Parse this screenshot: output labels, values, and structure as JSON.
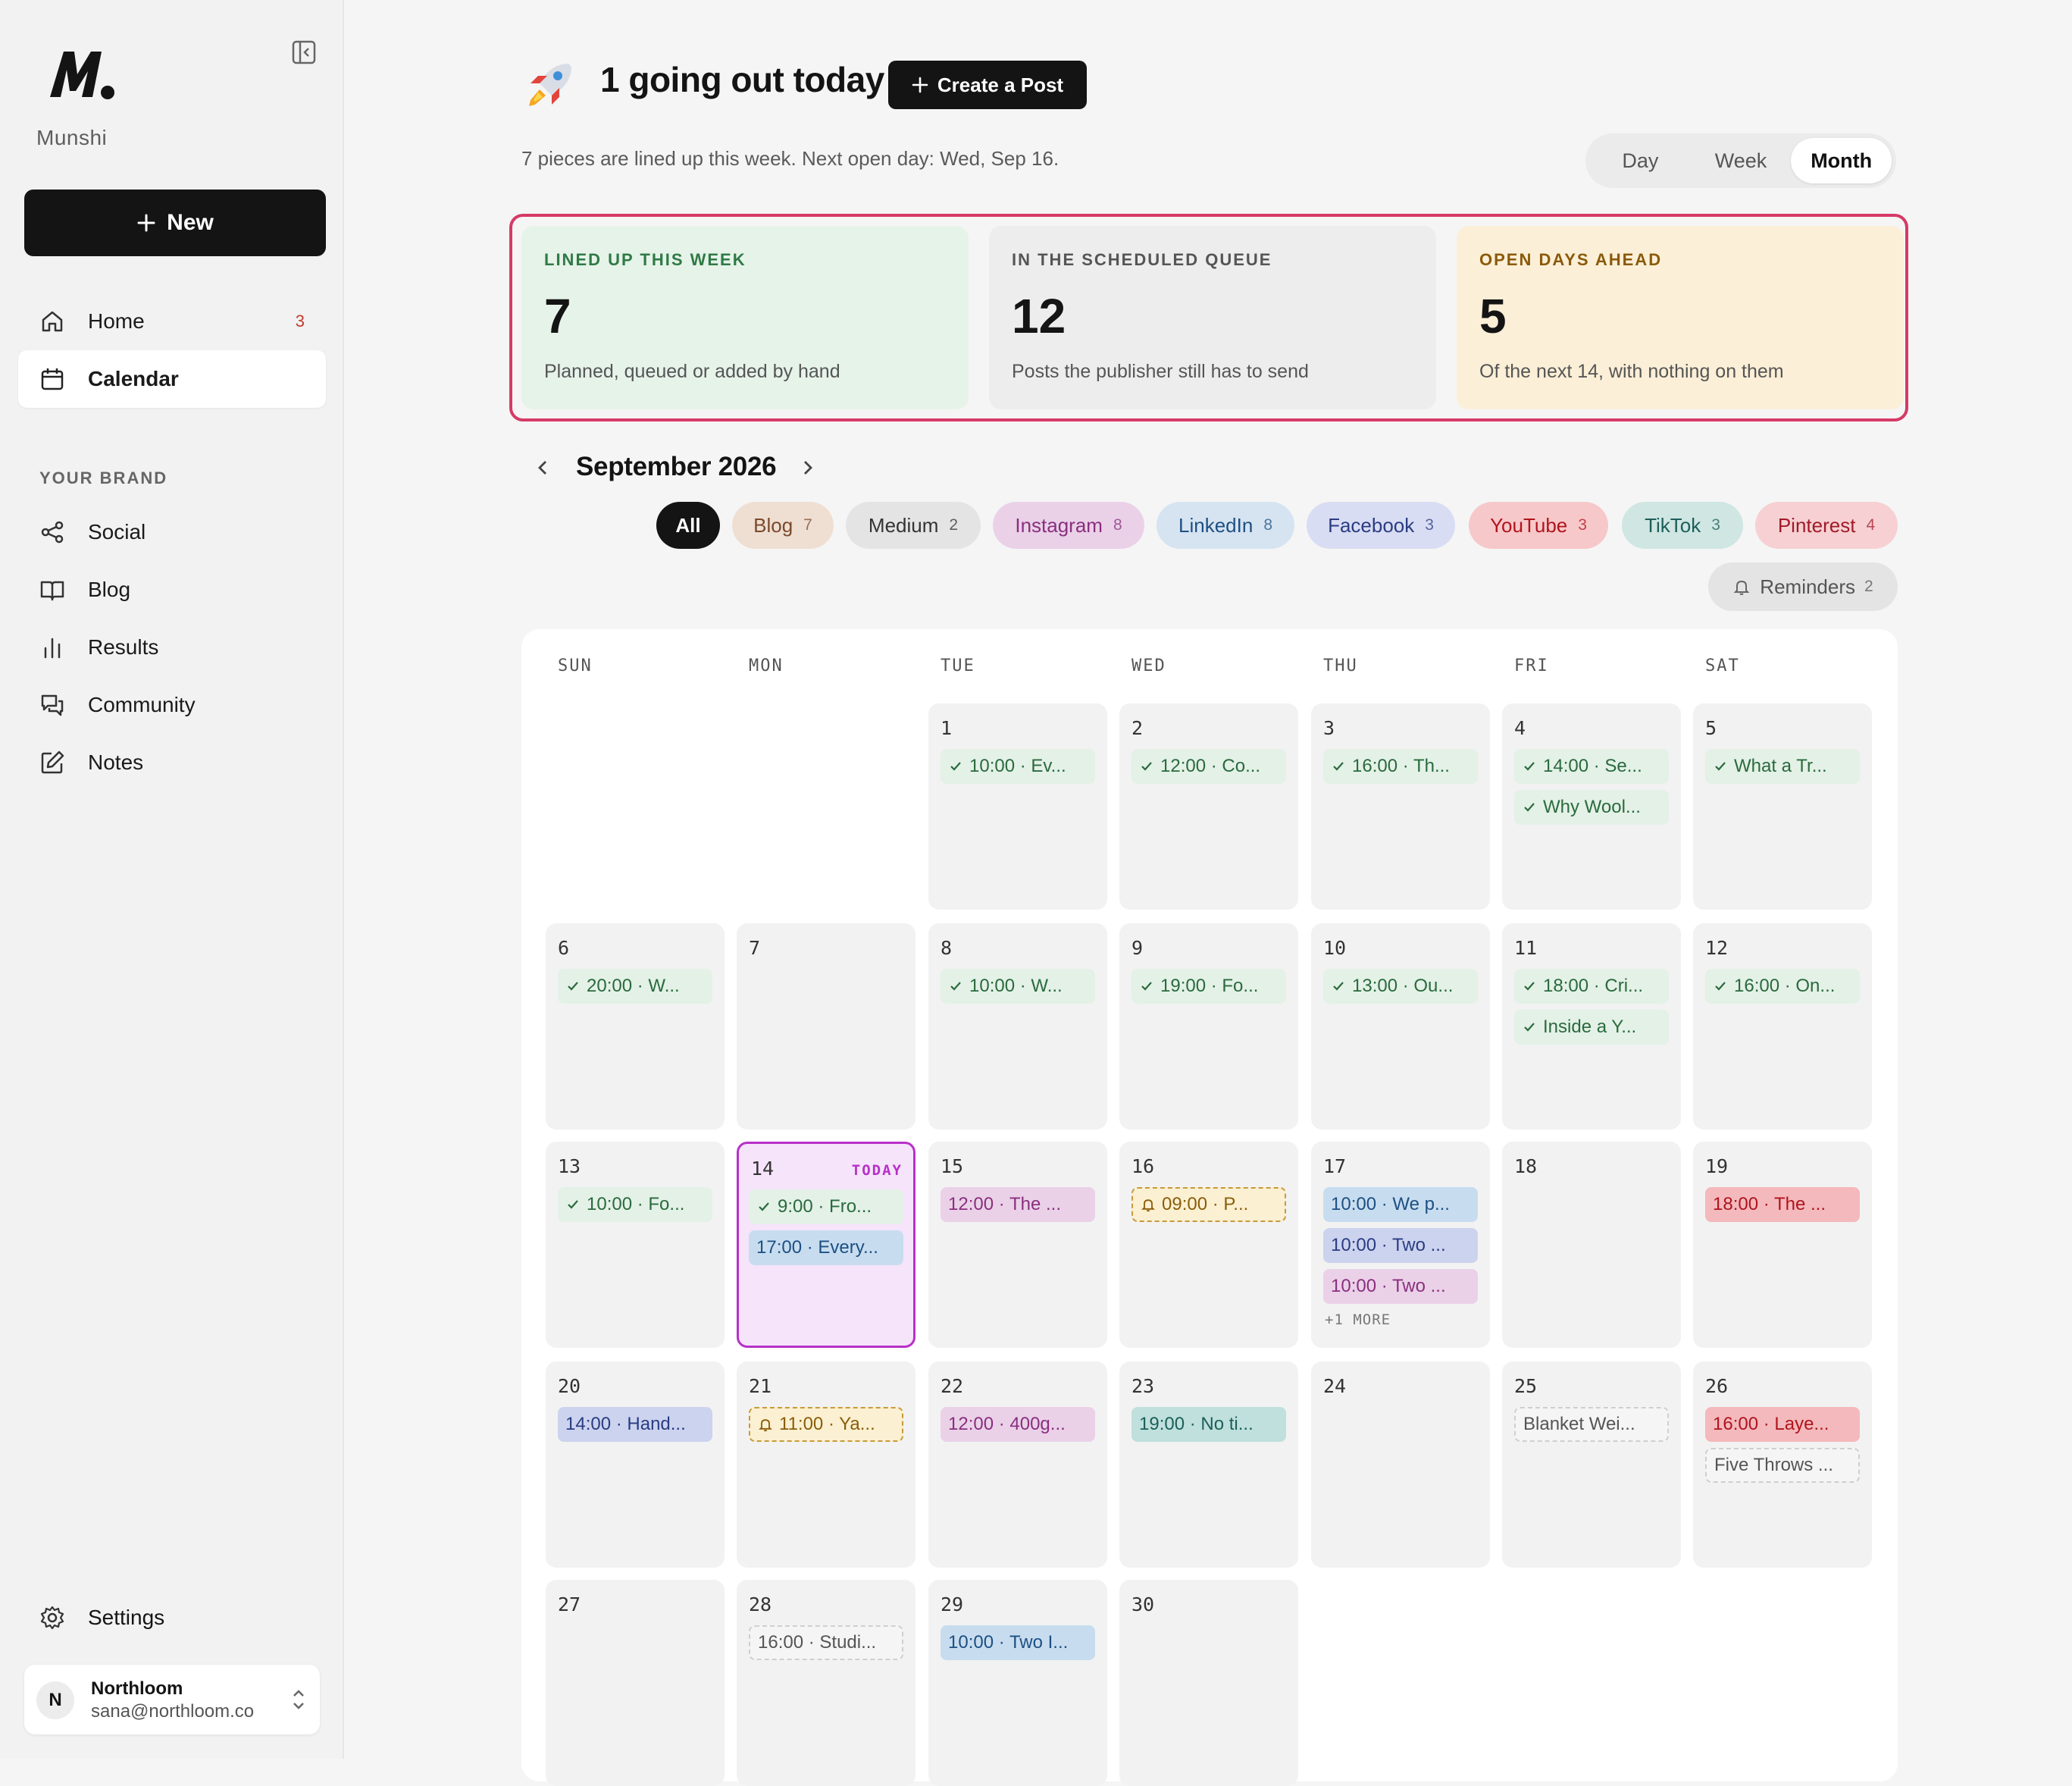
{
  "app": {
    "brand": "Munshi"
  },
  "sidebar": {
    "new_label": "New",
    "nav": [
      {
        "label": "Home",
        "icon": "home-icon",
        "count": "3"
      },
      {
        "label": "Calendar",
        "icon": "calendar-icon",
        "active": true
      }
    ],
    "section_label": "YOUR BRAND",
    "brand_items": [
      {
        "label": "Social",
        "icon": "share-icon"
      },
      {
        "label": "Blog",
        "icon": "book-icon"
      },
      {
        "label": "Results",
        "icon": "bar-chart-icon"
      },
      {
        "label": "Community",
        "icon": "chat-icon"
      },
      {
        "label": "Notes",
        "icon": "edit-icon"
      }
    ],
    "settings_label": "Settings",
    "account": {
      "initial": "N",
      "name": "Northloom",
      "email": "sana@northloom.co"
    }
  },
  "header": {
    "title": "1 going out today",
    "create_label": "Create a Post",
    "subtitle": "7 pieces are lined up this week. Next open day: Wed, Sep 16.",
    "views": [
      "Day",
      "Week",
      "Month"
    ],
    "active_view": "Month"
  },
  "stats": [
    {
      "label": "LINED UP THIS WEEK",
      "value": "7",
      "sub": "Planned, queued or added by hand",
      "bg": "#e6f3e9",
      "label_color": "#2e7a45"
    },
    {
      "label": "IN THE SCHEDULED QUEUE",
      "value": "12",
      "sub": "Posts the publisher still has to send",
      "bg": "#ededed",
      "label_color": "#555555"
    },
    {
      "label": "OPEN DAYS AHEAD",
      "value": "5",
      "sub": "Of the next 14, with nothing on them",
      "bg": "#fbefd7",
      "label_color": "#8a5a0a"
    }
  ],
  "calendar": {
    "month_title": "September 2026",
    "filters": [
      {
        "label": "All",
        "count": "",
        "bg": "#141414",
        "fg": "#ffffff"
      },
      {
        "label": "Blog",
        "count": "7",
        "bg": "#efdfd3",
        "fg": "#7a4a2a"
      },
      {
        "label": "Medium",
        "count": "2",
        "bg": "#e4e4e4",
        "fg": "#333333"
      },
      {
        "label": "Instagram",
        "count": "8",
        "bg": "#ead1e8",
        "fg": "#8a2f7e"
      },
      {
        "label": "LinkedIn",
        "count": "8",
        "bg": "#d6e4f1",
        "fg": "#1e4f83"
      },
      {
        "label": "Facebook",
        "count": "3",
        "bg": "#d9ddf3",
        "fg": "#2a3c83"
      },
      {
        "label": "YouTube",
        "count": "3",
        "bg": "#f7c8c9",
        "fg": "#b0141e"
      },
      {
        "label": "TikTok",
        "count": "3",
        "bg": "#cfe6e2",
        "fg": "#1d5e5a"
      },
      {
        "label": "Pinterest",
        "count": "4",
        "bg": "#f6d0d2",
        "fg": "#a01a2a"
      }
    ],
    "reminders": {
      "label": "Reminders",
      "count": "2"
    },
    "weekdays": [
      "SUN",
      "MON",
      "TUE",
      "WED",
      "THU",
      "FRI",
      "SAT"
    ],
    "today_label": "TODAY",
    "days": [
      {
        "num": "1",
        "events": [
          {
            "text": "10:00 · Ev...",
            "kind": "done"
          }
        ]
      },
      {
        "num": "2",
        "events": [
          {
            "text": "12:00 · Co...",
            "kind": "done"
          }
        ]
      },
      {
        "num": "3",
        "events": [
          {
            "text": "16:00 · Th...",
            "kind": "done"
          }
        ]
      },
      {
        "num": "4",
        "events": [
          {
            "text": "14:00 · Se...",
            "kind": "done"
          },
          {
            "text": "Why Wool...",
            "kind": "done"
          }
        ]
      },
      {
        "num": "5",
        "events": [
          {
            "text": "What a Tr...",
            "kind": "done"
          }
        ]
      },
      {
        "num": "6",
        "events": [
          {
            "text": "20:00 · W...",
            "kind": "done"
          }
        ]
      },
      {
        "num": "7",
        "events": []
      },
      {
        "num": "8",
        "events": [
          {
            "text": "10:00 · W...",
            "kind": "done"
          }
        ]
      },
      {
        "num": "9",
        "events": [
          {
            "text": "19:00 · Fo...",
            "kind": "done"
          }
        ]
      },
      {
        "num": "10",
        "events": [
          {
            "text": "13:00 · Ou...",
            "kind": "done"
          }
        ]
      },
      {
        "num": "11",
        "events": [
          {
            "text": "18:00 · Cri...",
            "kind": "done"
          },
          {
            "text": "Inside a Y...",
            "kind": "done"
          }
        ]
      },
      {
        "num": "12",
        "events": [
          {
            "text": "16:00 · On...",
            "kind": "done"
          }
        ]
      },
      {
        "num": "13",
        "events": [
          {
            "text": "10:00 · Fo...",
            "kind": "done"
          }
        ]
      },
      {
        "num": "14",
        "today": true,
        "events": [
          {
            "text": "9:00 · Fro...",
            "kind": "done"
          },
          {
            "text": "17:00 · Every...",
            "kind": "linkedin"
          }
        ]
      },
      {
        "num": "15",
        "events": [
          {
            "text": "12:00 · The ...",
            "kind": "instagram"
          }
        ]
      },
      {
        "num": "16",
        "events": [
          {
            "text": "09:00 · P...",
            "kind": "reminder"
          }
        ]
      },
      {
        "num": "17",
        "events": [
          {
            "text": "10:00 · We p...",
            "kind": "linkedin"
          },
          {
            "text": "10:00 · Two ...",
            "kind": "facebook"
          },
          {
            "text": "10:00 · Two ...",
            "kind": "instagram"
          }
        ],
        "more": "+1 MORE"
      },
      {
        "num": "18",
        "events": []
      },
      {
        "num": "19",
        "events": [
          {
            "text": "18:00 · The ...",
            "kind": "youtube"
          }
        ]
      },
      {
        "num": "20",
        "events": [
          {
            "text": "14:00 · Hand...",
            "kind": "facebook"
          }
        ]
      },
      {
        "num": "21",
        "events": [
          {
            "text": "11:00 · Ya...",
            "kind": "reminder"
          }
        ]
      },
      {
        "num": "22",
        "events": [
          {
            "text": "12:00 · 400g...",
            "kind": "instagram"
          }
        ]
      },
      {
        "num": "23",
        "events": [
          {
            "text": "19:00 · No ti...",
            "kind": "tiktok"
          }
        ]
      },
      {
        "num": "24",
        "events": []
      },
      {
        "num": "25",
        "events": [
          {
            "text": "Blanket Wei...",
            "kind": "draft"
          }
        ]
      },
      {
        "num": "26",
        "events": [
          {
            "text": "16:00 · Laye...",
            "kind": "pinterest"
          },
          {
            "text": "Five Throws ...",
            "kind": "draft"
          }
        ]
      },
      {
        "num": "27",
        "events": []
      },
      {
        "num": "28",
        "events": [
          {
            "text": "16:00 · Studi...",
            "kind": "draft"
          }
        ]
      },
      {
        "num": "29",
        "events": [
          {
            "text": "10:00 · Two I...",
            "kind": "linkedin"
          }
        ]
      },
      {
        "num": "30",
        "events": []
      }
    ]
  }
}
